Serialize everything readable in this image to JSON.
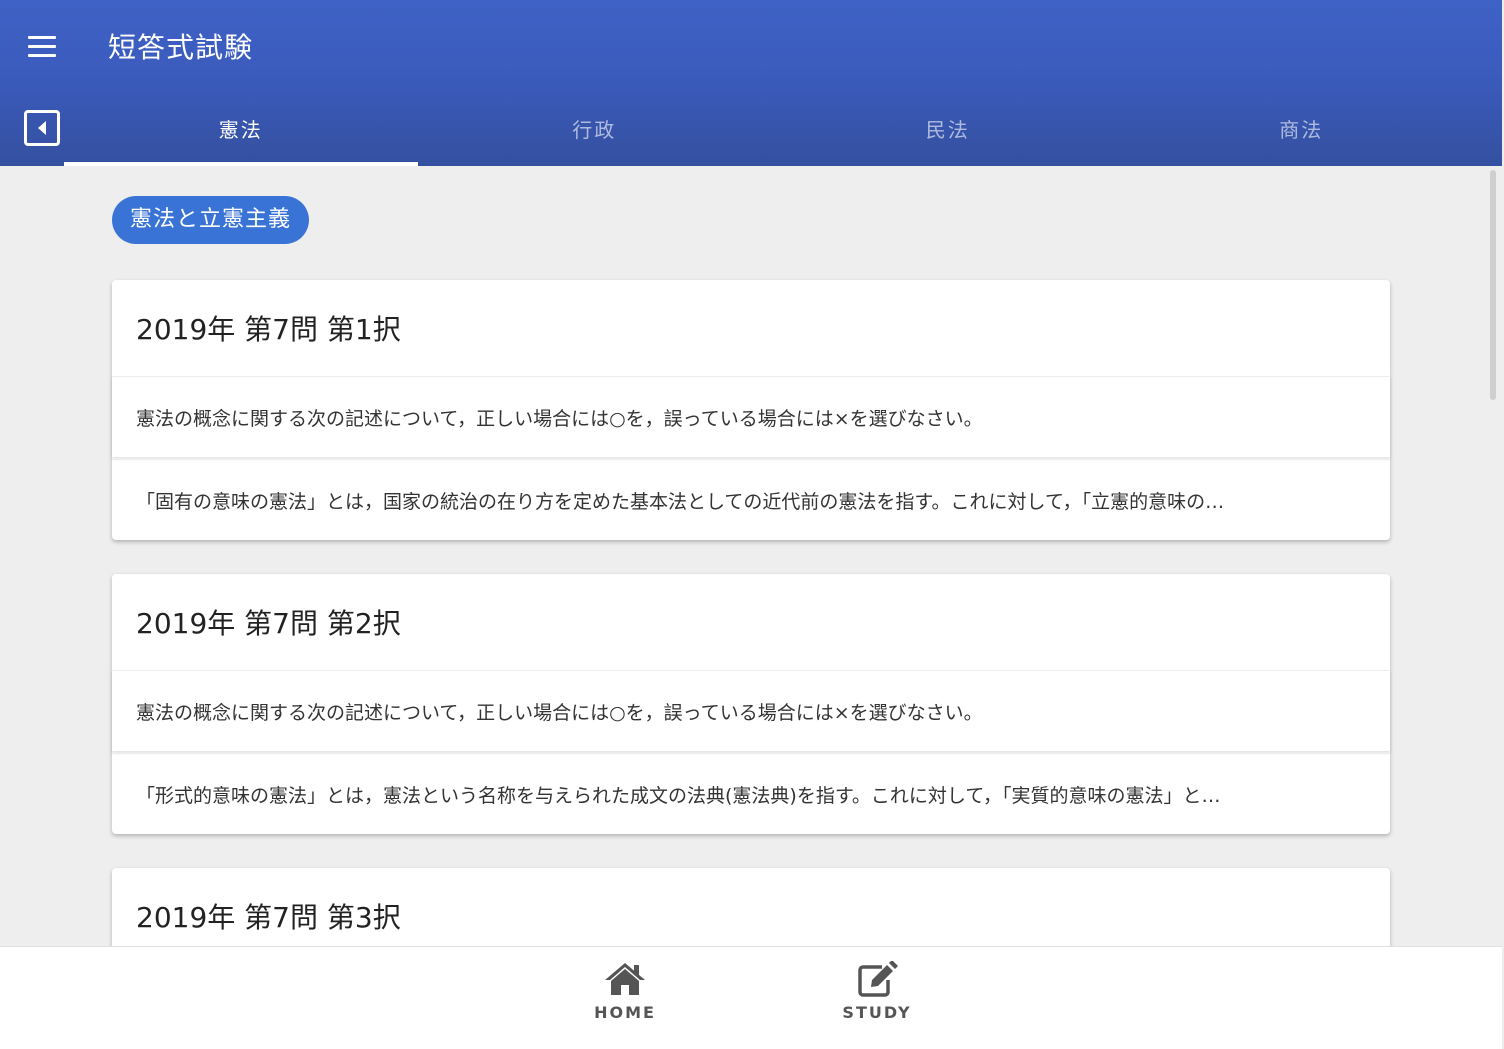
{
  "appbar": {
    "title": "短答式試験",
    "menu_icon": "hamburger-menu-icon",
    "back_icon": "back-arrow-icon"
  },
  "tabs": [
    {
      "label": "憲法",
      "active": true
    },
    {
      "label": "行政",
      "active": false
    },
    {
      "label": "民法",
      "active": false
    },
    {
      "label": "商法",
      "active": false
    }
  ],
  "category_chip": "憲法と立憲主義",
  "questions": [
    {
      "title": "2019年 第7問 第1択",
      "prompt": "憲法の概念に関する次の記述について，正しい場合には○を，誤っている場合には×を選びなさい。",
      "statement": "「固有の意味の憲法」とは，国家の統治の在り方を定めた基本法としての近代前の憲法を指す。これに対して，「立憲的意味の…"
    },
    {
      "title": "2019年 第7問 第2択",
      "prompt": "憲法の概念に関する次の記述について，正しい場合には○を，誤っている場合には×を選びなさい。",
      "statement": "「形式的意味の憲法」とは，憲法という名称を与えられた成文の法典(憲法典)を指す。これに対して，「実質的意味の憲法」と…"
    },
    {
      "title": "2019年 第7問 第3択"
    }
  ],
  "bottom_nav": {
    "home_label": "HOME",
    "study_label": "STUDY"
  },
  "colors": {
    "appbar": "#3b5bbd",
    "chip": "#3a73d6",
    "background": "#eeeeee"
  }
}
